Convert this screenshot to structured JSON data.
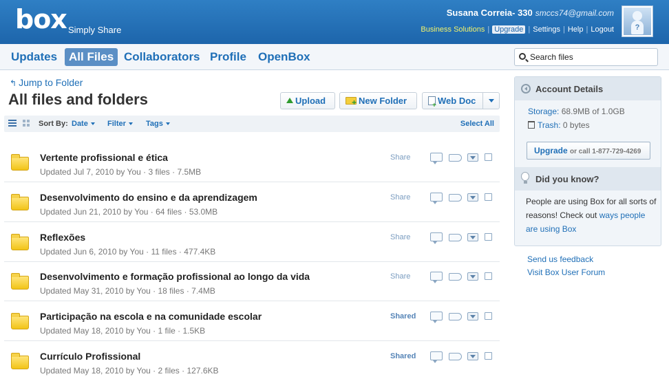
{
  "header": {
    "logo": "box",
    "tagline": "Simply Share",
    "user_name": "Susana Correia- 330",
    "user_email": "smccs74@gmail.com",
    "links": {
      "business": "Business Solutions",
      "upgrade": "Upgrade",
      "settings": "Settings",
      "help": "Help",
      "logout": "Logout"
    }
  },
  "nav": {
    "items": [
      "Updates",
      "All Files",
      "Collaborators",
      "Profile",
      "OpenBox"
    ],
    "active": "All Files",
    "search_placeholder": "Search files"
  },
  "main": {
    "jump_to_folder": "Jump to Folder",
    "title": "All files and folders",
    "buttons": {
      "upload": "Upload",
      "new_folder": "New Folder",
      "web_doc": "Web Doc"
    },
    "toolbar": {
      "sort_by": "Sort By:",
      "date": "Date",
      "filter": "Filter",
      "tags": "Tags",
      "select_all": "Select All"
    },
    "files": [
      {
        "name": "Vertente profissional e ética",
        "meta": "Updated Jul 7, 2010 by You  ·  3 files  ·  7.5MB",
        "share": "Share",
        "shared": false
      },
      {
        "name": "Desenvolvimento do ensino e da aprendizagem",
        "meta": "Updated Jun 21, 2010 by You  ·  64 files  ·  53.0MB",
        "share": "Share",
        "shared": false
      },
      {
        "name": "Reflexões",
        "meta": "Updated Jun 6, 2010 by You  ·  11 files  ·  477.4KB",
        "share": "Share",
        "shared": false
      },
      {
        "name": "Desenvolvimento e formação profissional ao longo da vida",
        "meta": "Updated May 31, 2010 by You  ·  18 files  ·  7.4MB",
        "share": "Share",
        "shared": false
      },
      {
        "name": "Participação na escola e na comunidade escolar",
        "meta": "Updated May 18, 2010 by You  ·  1 file  ·  1.5KB",
        "share": "Shared",
        "shared": true
      },
      {
        "name": "Currículo Profissional",
        "meta": "Updated May 18, 2010 by You  ·  2 files  ·  127.6KB",
        "share": "Shared",
        "shared": true
      }
    ]
  },
  "sidebar": {
    "account_title": "Account Details",
    "storage_label": "Storage:",
    "storage_value": "68.9MB of 1.0GB",
    "trash_label": "Trash:",
    "trash_value": "0 bytes",
    "upgrade_label": "Upgrade",
    "upgrade_call": "or call 1-877-729-4269",
    "dyk_title": "Did you know?",
    "dyk_text": "People are using Box for all sorts of reasons! Check out ",
    "dyk_link": "ways people are using Box",
    "feedback": "Send us feedback",
    "forum": "Visit Box User Forum"
  },
  "colors": {
    "header_blue": "#1d65ab",
    "link_blue": "#1f6fb7",
    "active_tab": "#5b8fc5"
  }
}
